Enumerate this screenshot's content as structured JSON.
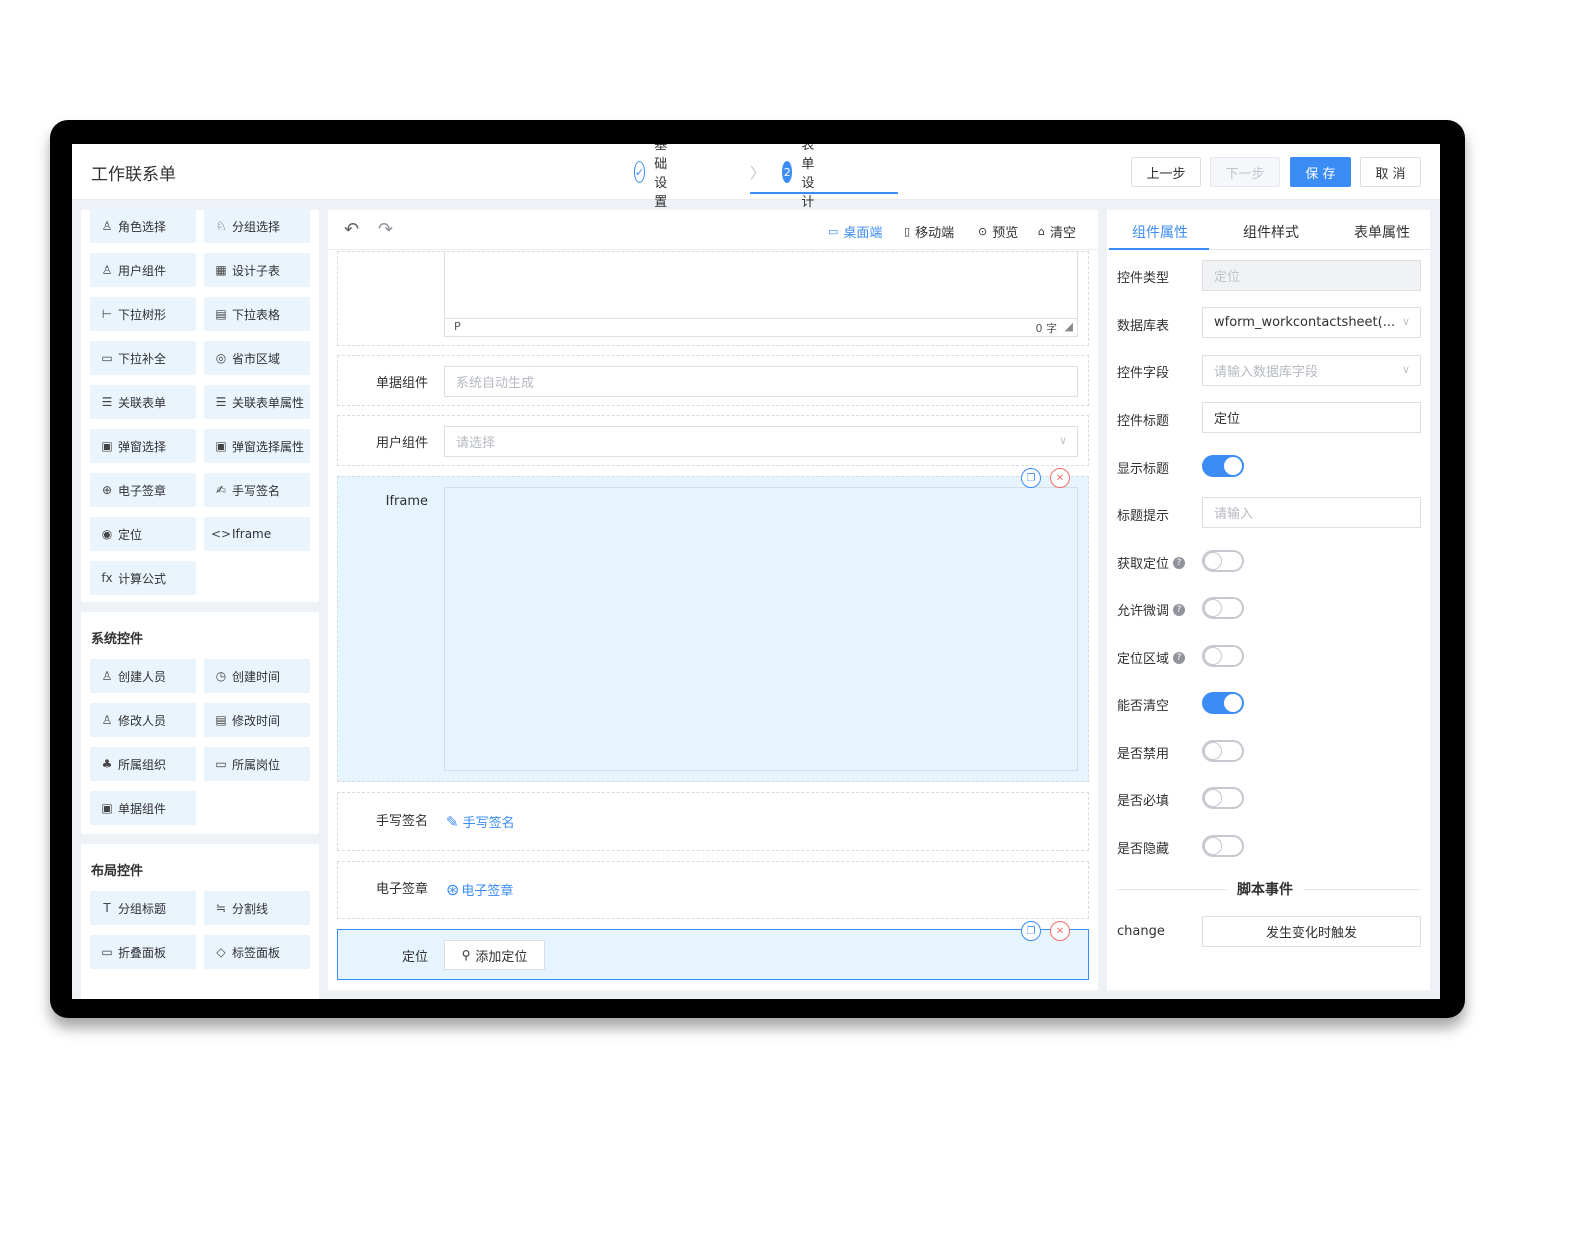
{
  "header": {
    "title": "工作联系单",
    "steps": [
      {
        "index": "✓",
        "label": "基础设置"
      },
      {
        "index": "2",
        "label": "表单设计"
      }
    ],
    "buttons": {
      "prev": "上一步",
      "next": "下一步",
      "save": "保 存",
      "cancel": "取 消"
    }
  },
  "palette": {
    "basic_items": [
      {
        "icon": "person-badge-icon",
        "glyph": "♙",
        "label": "角色选择"
      },
      {
        "icon": "group-icon",
        "glyph": "♘",
        "label": "分组选择"
      },
      {
        "icon": "user-icon",
        "glyph": "♙",
        "label": "用户组件"
      },
      {
        "icon": "table-icon",
        "glyph": "▦",
        "label": "设计子表"
      },
      {
        "icon": "tree-icon",
        "glyph": "⊢",
        "label": "下拉树形"
      },
      {
        "icon": "grid-icon",
        "glyph": "▤",
        "label": "下拉表格"
      },
      {
        "icon": "autocomplete-icon",
        "glyph": "▭",
        "label": "下拉补全"
      },
      {
        "icon": "map-region-icon",
        "glyph": "◎",
        "label": "省市区域"
      },
      {
        "icon": "form-link-icon",
        "glyph": "☰",
        "label": "关联表单"
      },
      {
        "icon": "form-attr-icon",
        "glyph": "☰",
        "label": "关联表单属性"
      },
      {
        "icon": "popup-select-icon",
        "glyph": "▣",
        "label": "弹窗选择"
      },
      {
        "icon": "popup-attr-icon",
        "glyph": "▣",
        "label": "弹窗选择属性"
      },
      {
        "icon": "seal-icon",
        "glyph": "⊕",
        "label": "电子签章"
      },
      {
        "icon": "signature-icon",
        "glyph": "✍",
        "label": "手写签名"
      },
      {
        "icon": "location-pin-icon",
        "glyph": "◉",
        "label": "定位"
      },
      {
        "icon": "code-icon",
        "glyph": "<>",
        "label": "Iframe"
      },
      {
        "icon": "formula-icon",
        "glyph": "fx",
        "label": "计算公式"
      }
    ],
    "system_title": "系统控件",
    "system_items": [
      {
        "icon": "creator-icon",
        "glyph": "♙",
        "label": "创建人员"
      },
      {
        "icon": "clock-icon",
        "glyph": "◷",
        "label": "创建时间"
      },
      {
        "icon": "editor-icon",
        "glyph": "♙",
        "label": "修改人员"
      },
      {
        "icon": "calendar-icon",
        "glyph": "▤",
        "label": "修改时间"
      },
      {
        "icon": "org-icon",
        "glyph": "♣",
        "label": "所属组织"
      },
      {
        "icon": "position-icon",
        "glyph": "▭",
        "label": "所属岗位"
      },
      {
        "icon": "bill-icon",
        "glyph": "▣",
        "label": "单据组件"
      }
    ],
    "layout_title": "布局控件",
    "layout_items": [
      {
        "icon": "heading-icon",
        "glyph": "T",
        "label": "分组标题"
      },
      {
        "icon": "divider-icon",
        "glyph": "≒",
        "label": "分割线"
      },
      {
        "icon": "folder-icon",
        "glyph": "▭",
        "label": "折叠面板"
      },
      {
        "icon": "tag-icon",
        "glyph": "◇",
        "label": "标签面板"
      }
    ]
  },
  "canvas": {
    "toolbar": {
      "desktop": "桌面端",
      "mobile": "移动端",
      "preview": "预览",
      "clear": "清空"
    },
    "rich_status_left": "P",
    "rich_status_right": "0 字",
    "fields": {
      "bill": {
        "label": "单据组件",
        "placeholder": "系统自动生成"
      },
      "user": {
        "label": "用户组件",
        "placeholder": "请选择"
      },
      "iframe": {
        "label": "Iframe"
      },
      "signature": {
        "label": "手写签名",
        "button": "手写签名"
      },
      "seal": {
        "label": "电子签章",
        "button": "电子签章"
      },
      "location": {
        "label": "定位",
        "button": "添加定位"
      }
    }
  },
  "props": {
    "tabs": [
      "组件属性",
      "组件样式",
      "表单属性"
    ],
    "rows": {
      "type": {
        "label": "控件类型",
        "value": "定位"
      },
      "table": {
        "label": "数据库表",
        "value": "wform_workcontactsheet(..."
      },
      "field": {
        "label": "控件字段",
        "placeholder": "请输入数据库字段"
      },
      "title": {
        "label": "控件标题",
        "value": "定位"
      },
      "show_title": {
        "label": "显示标题",
        "on": true
      },
      "tip": {
        "label": "标题提示",
        "placeholder": "请输入"
      },
      "get_loc": {
        "label": "获取定位",
        "on": false
      },
      "fine_tune": {
        "label": "允许微调",
        "on": false
      },
      "region": {
        "label": "定位区域",
        "on": false
      },
      "clearable": {
        "label": "能否清空",
        "on": true
      },
      "disabled": {
        "label": "是否禁用",
        "on": false
      },
      "required": {
        "label": "是否必填",
        "on": false
      },
      "hidden": {
        "label": "是否隐藏",
        "on": false
      }
    },
    "script_title": "脚本事件",
    "event": {
      "name": "change",
      "button": "发生变化时触发"
    }
  },
  "colors": {
    "accent": "#3b8cf5",
    "danger": "#f56c6c",
    "selected_bg": "#e6f4fd"
  }
}
